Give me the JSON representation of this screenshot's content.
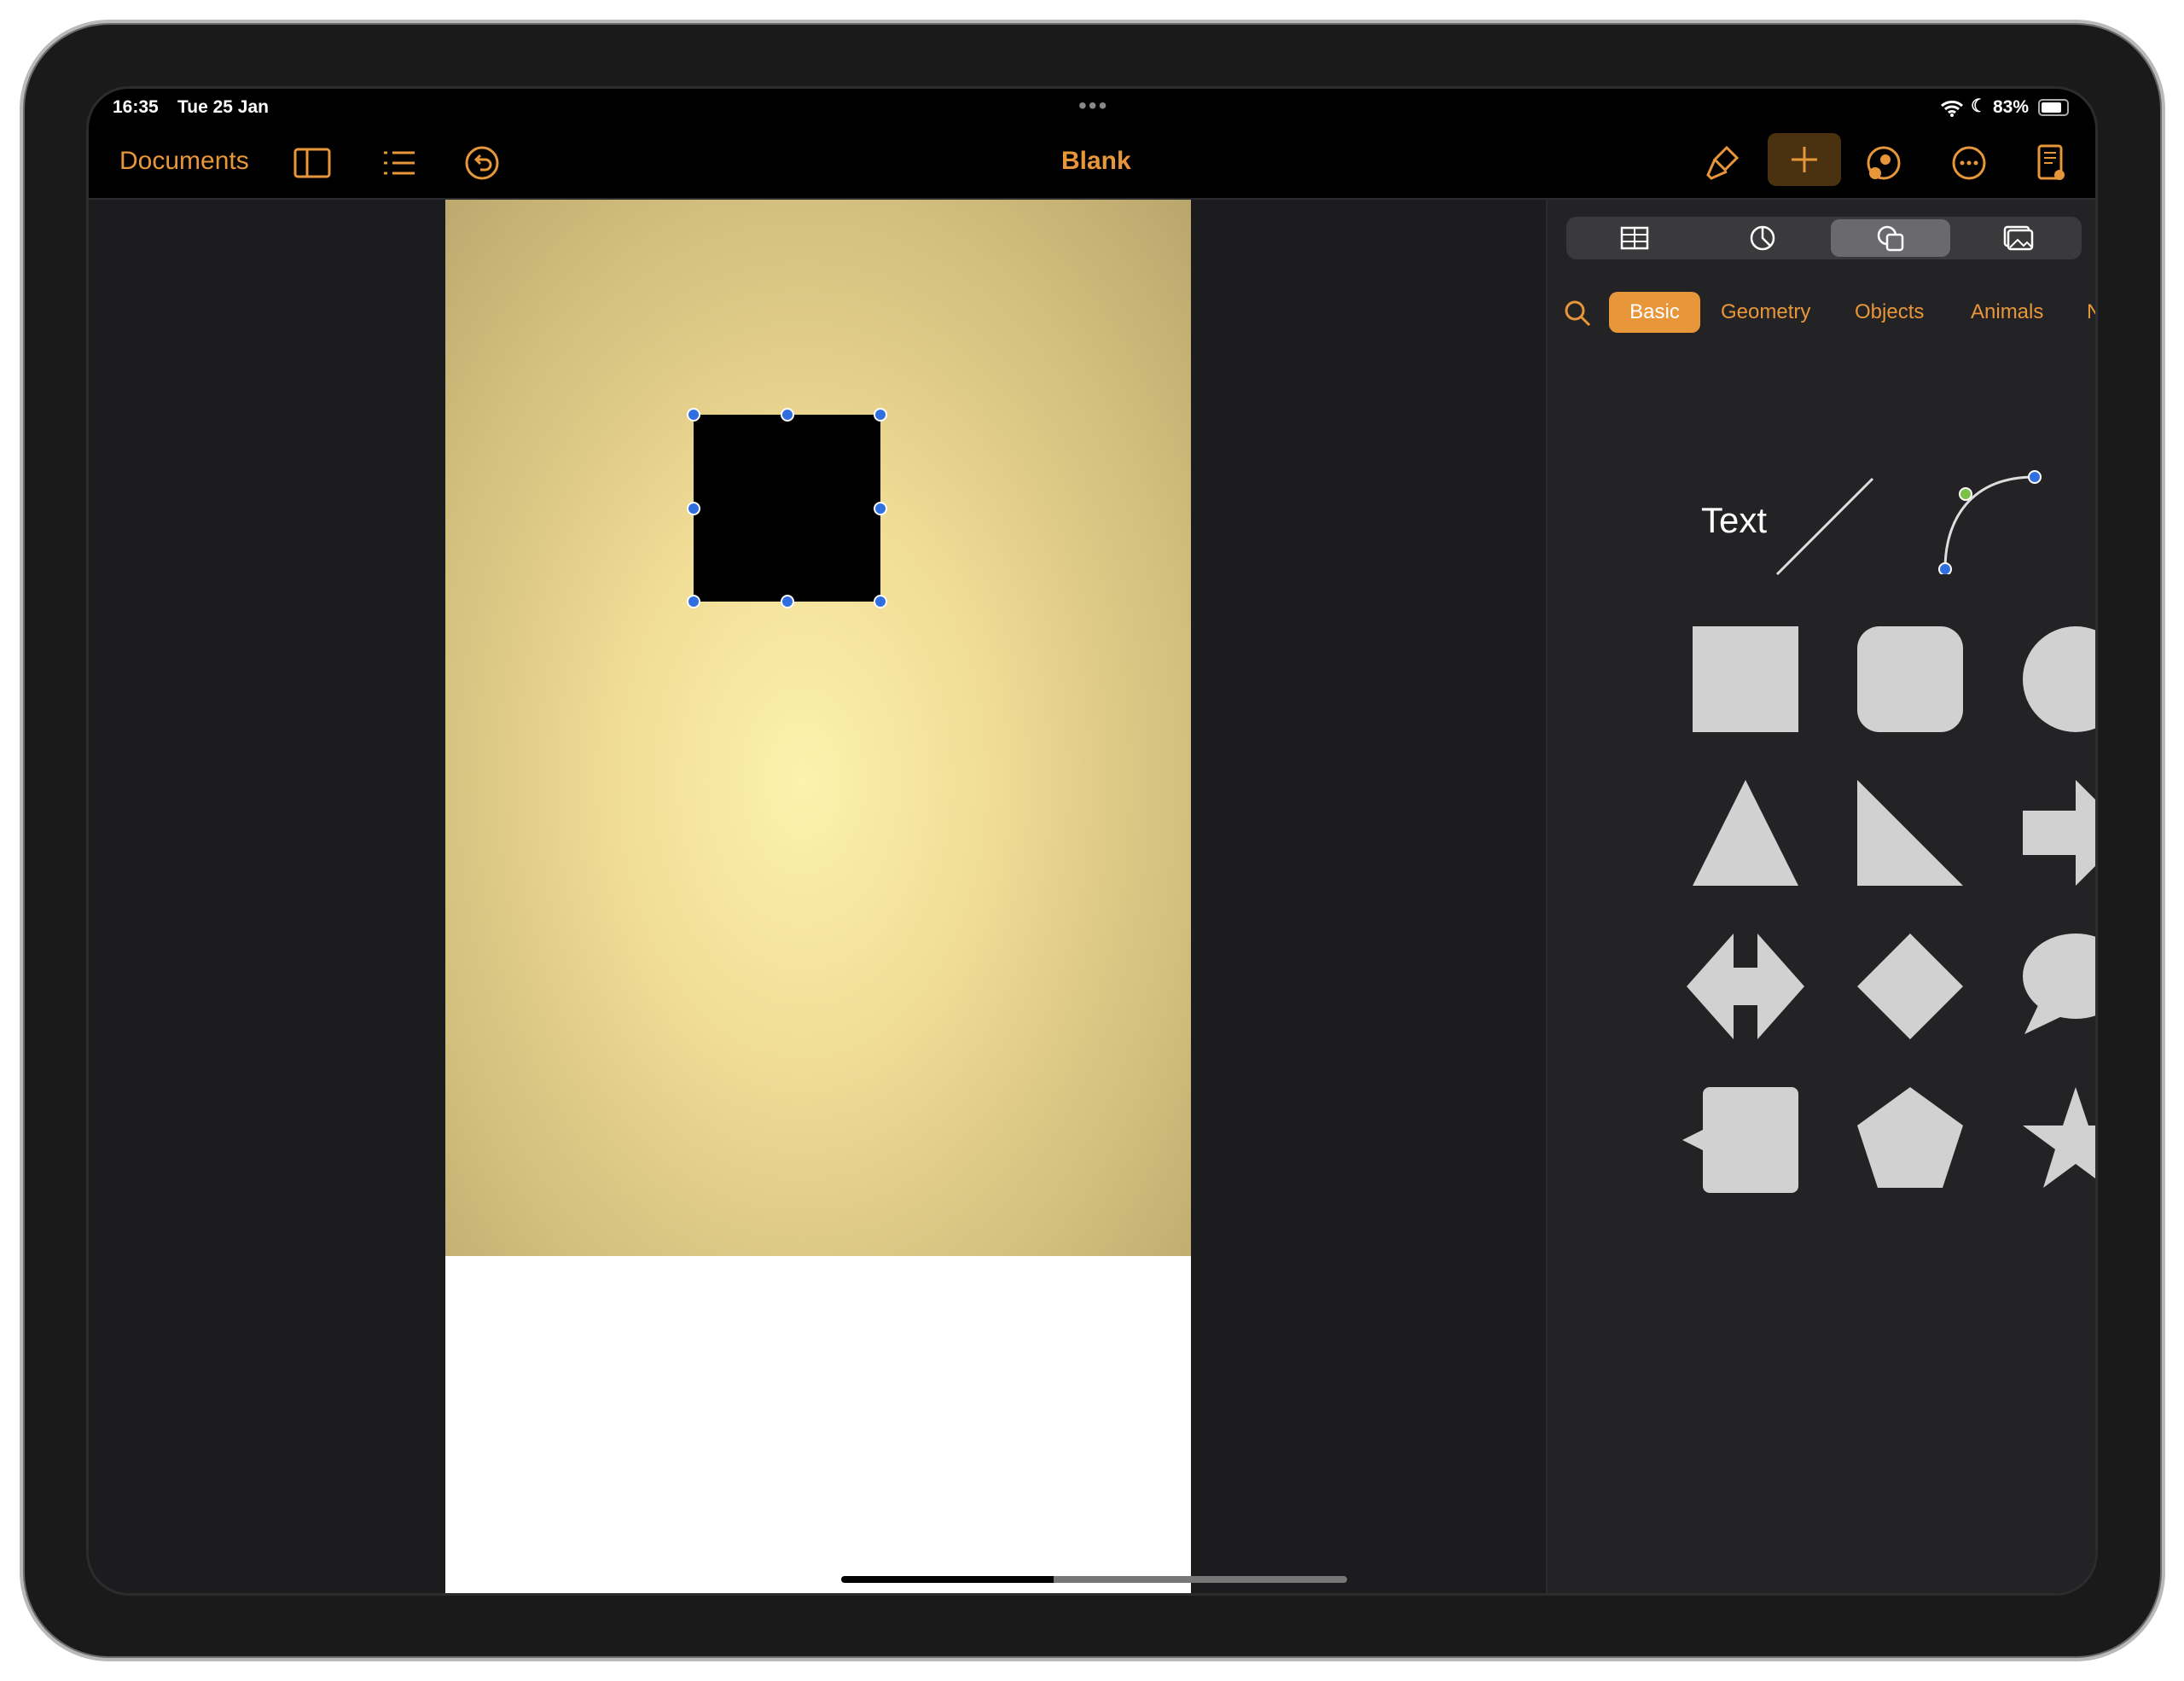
{
  "status": {
    "time": "16:35",
    "date": "Tue 25 Jan",
    "battery": "83%",
    "battery_level": 0.83
  },
  "toolbar": {
    "documents": "Documents",
    "title": "Blank"
  },
  "panel": {
    "tabs": [
      "table-icon",
      "chart-icon",
      "shapes-icon",
      "media-icon"
    ],
    "selected_tab": "shapes",
    "categories": [
      "Basic",
      "Geometry",
      "Objects",
      "Animals",
      "N"
    ],
    "selected_category": "Basic",
    "text_shape": "Text"
  },
  "colors": {
    "accent": "#e8963a",
    "shape_fill": "#d1d1d1",
    "handle": "#2f6fe0"
  }
}
